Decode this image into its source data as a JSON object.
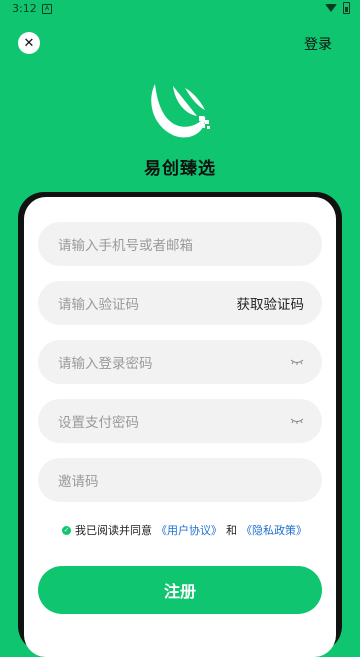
{
  "status_bar": {
    "time": "3:12",
    "badge": "A"
  },
  "header": {
    "close_icon": "close-icon",
    "login_label": "登录"
  },
  "brand": {
    "name": "易创臻选"
  },
  "form": {
    "phone_placeholder": "请输入手机号或者邮箱",
    "code_placeholder": "请输入验证码",
    "get_code_label": "获取验证码",
    "password_placeholder": "请输入登录密码",
    "pay_password_placeholder": "设置支付密码",
    "invite_placeholder": "邀请码"
  },
  "agreement": {
    "prefix": "我已阅读并同意",
    "user_agreement": "《用户协议》",
    "and": "和",
    "privacy_policy": "《隐私政策》"
  },
  "register_label": "注册",
  "colors": {
    "brand_green": "#0fc56f",
    "link_blue": "#1f6fd1",
    "card_border": "#111111"
  }
}
